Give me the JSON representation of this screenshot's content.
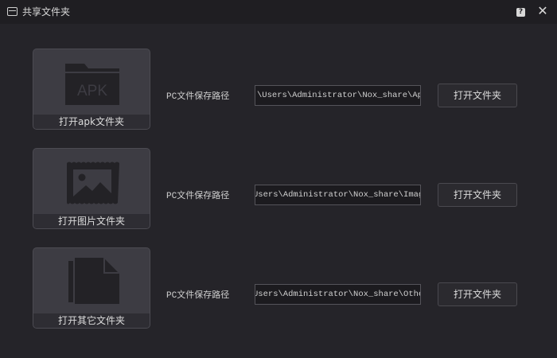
{
  "window": {
    "title": "共享文件夹",
    "help_label": "?",
    "close_label": "✕"
  },
  "rows": [
    {
      "tile_label": "打开apk文件夹",
      "tile_icon": "apk-folder-icon",
      "tile_icon_text": "APK",
      "path_label": "PC文件保存路径",
      "path_value": "\\Users\\Administrator\\Nox_share\\App",
      "button_label": "打开文件夹"
    },
    {
      "tile_label": "打开图片文件夹",
      "tile_icon": "image-icon",
      "path_label": "PC文件保存路径",
      "path_value": "Users\\Administrator\\Nox_share\\Image",
      "button_label": "打开文件夹"
    },
    {
      "tile_label": "打开其它文件夹",
      "tile_icon": "document-icon",
      "path_label": "PC文件保存路径",
      "path_value": "Users\\Administrator\\Nox_share\\Other",
      "button_label": "打开文件夹"
    }
  ],
  "colors": {
    "background": "#252429",
    "titlebar": "#1f1e22",
    "tile": "#3d3c43",
    "icon": "#232226"
  }
}
